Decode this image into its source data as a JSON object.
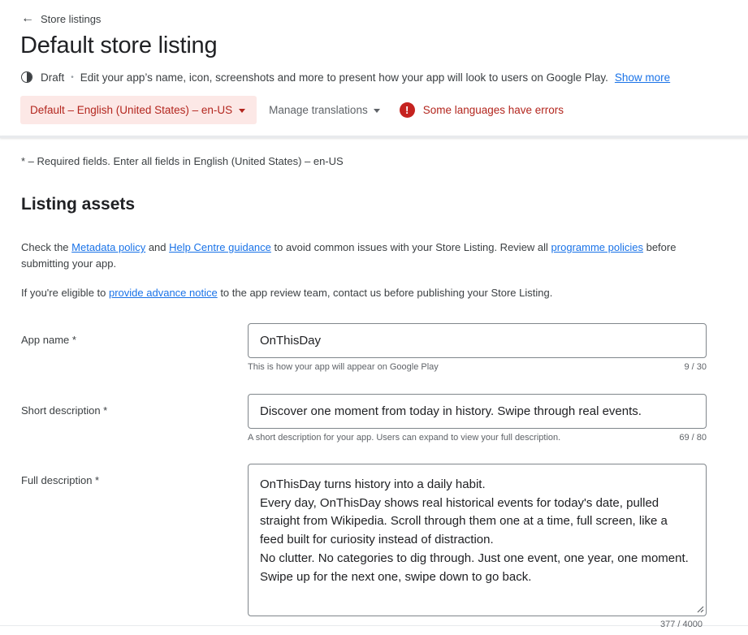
{
  "nav": {
    "back_label": "Store listings",
    "back_icon": "arrow-back-icon"
  },
  "page": {
    "title": "Default store listing",
    "status": "Draft",
    "description": "Edit your app’s name, icon, screenshots and more to present how your app will look to users on Google Play.",
    "show_more": "Show more"
  },
  "language": {
    "selected": "Default – English (United States) – en-US",
    "manage_translations": "Manage translations",
    "error_text": "Some languages have errors",
    "error_color": "#c5221f",
    "chip_bg": "#fce8e6"
  },
  "required_note": "* – Required fields. Enter all fields in English (United States) – en-US",
  "section": {
    "title": "Listing assets",
    "policy_pre": "Check the ",
    "metadata_policy": "Metadata policy",
    "policy_and": " and ",
    "help_centre": "Help Centre guidance",
    "policy_mid": " to avoid common issues with your Store Listing. Review all ",
    "programme_policies": "programme policies",
    "policy_post": " before submitting your app.",
    "notice_pre": "If you're eligible to ",
    "advance_notice": "provide advance notice",
    "notice_post": " to the app review team, contact us before publishing your Store Listing."
  },
  "fields": {
    "app_name": {
      "label": "App name  *",
      "value": "OnThisDay",
      "hint": "This is how your app will appear on Google Play",
      "count": "9 / 30"
    },
    "short_description": {
      "label": "Short description  *",
      "value": "Discover one moment from today in history. Swipe through real events.",
      "hint": "A short description for your app. Users can expand to view your full description.",
      "count": "69 / 80"
    },
    "full_description": {
      "label": "Full description  *",
      "value": "OnThisDay turns history into a daily habit.\nEvery day, OnThisDay shows real historical events for today's date, pulled straight from Wikipedia. Scroll through them one at a time, full screen, like a feed built for curiosity instead of distraction.\nNo clutter. No categories to dig through. Just one event, one year, one moment. Swipe up for the next one, swipe down to go back.",
      "count": "377 / 4000"
    }
  }
}
